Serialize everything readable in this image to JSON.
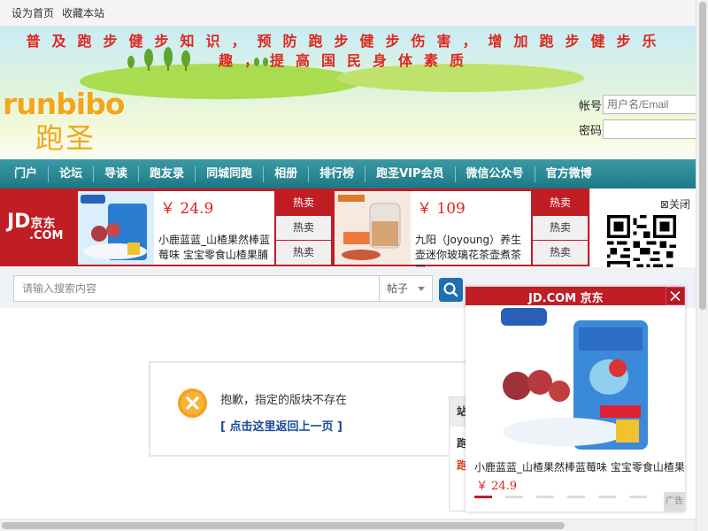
{
  "topbar": {
    "links": [
      "设为首页",
      "收藏本站"
    ]
  },
  "header": {
    "slogan": "普及跑步健步知识，预防跑步健步伤害，增加跑步健步乐趣，提高国民身体素质",
    "logo_en": "runbibo",
    "logo_cn": "跑圣",
    "login": {
      "account_label": "帐号",
      "account_placeholder": "用户名/Email",
      "password_label": "密码"
    }
  },
  "nav": {
    "items": [
      "门户",
      "论坛",
      "导读",
      "跑友录",
      "同城同跑",
      "相册",
      "排行榜",
      "跑圣VIP会员",
      "微信公众号",
      "官方微博"
    ]
  },
  "jd_banner": {
    "logo_jd": "JD",
    "logo_cn": "京东",
    "logo_com": ".COM",
    "products": [
      {
        "price": "￥ 24.9",
        "title": "小鹿蓝蓝_山楂果然棒蓝莓味 宝宝零食山楂果脯"
      },
      {
        "price": "￥ 109",
        "title": "九阳（Joyoung）养生壶迷你玻璃花茶壶煮茶器"
      }
    ],
    "hot_label": "热卖"
  },
  "qr": {
    "close_label": "关闭",
    "close_icon": "⊠"
  },
  "search": {
    "placeholder": "请输入搜索内容",
    "type": "帖子"
  },
  "alert": {
    "message": "抱歉，指定的版块不存在",
    "link": "[ 点击这里返回上一页 ]"
  },
  "side_box": {
    "head": "站",
    "line1": "跑",
    "line2": "跑"
  },
  "float_ad": {
    "brand": "JD.COM 京东",
    "title": "小鹿蓝蓝_山楂果然棒蓝莓味 宝宝零食山楂果",
    "price": "￥ 24.9",
    "ad_tag": "广告"
  },
  "colors": {
    "nav_bg": "#1d7885",
    "jd_red": "#c11d24",
    "slogan_red": "#e0261d",
    "logo_orange": "#f2a71b",
    "link_blue": "#1a4a99"
  }
}
